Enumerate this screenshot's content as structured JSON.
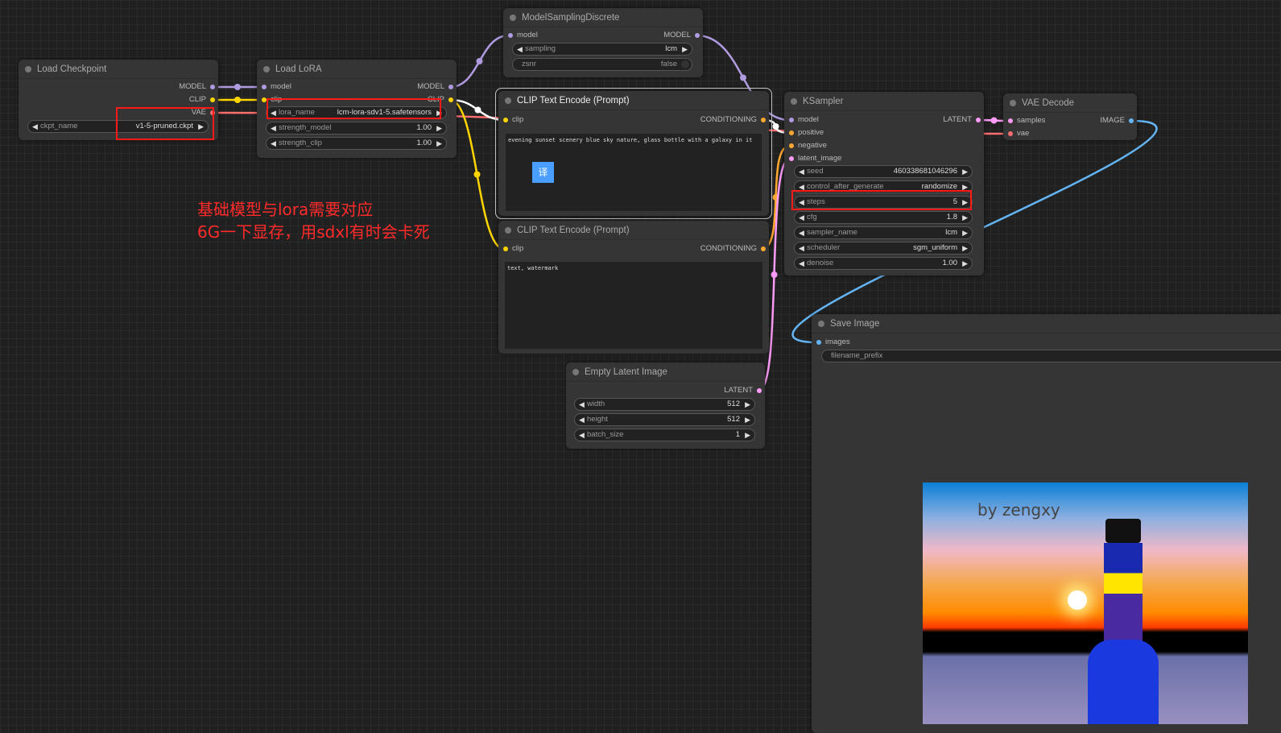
{
  "colors": {
    "model": "#b09ae0",
    "clip": "#ffd500",
    "vae": "#ff6e6e",
    "conditioning": "#ffa931",
    "latent": "#ff9cf9",
    "image": "#64b5f6",
    "highlight": "#ff1a1a"
  },
  "annotation": {
    "line1": "基础模型与lora需要对应",
    "line2": "6G一下显存，用sdxl有时会卡死"
  },
  "load_checkpoint": {
    "title": "Load Checkpoint",
    "outputs": [
      "MODEL",
      "CLIP",
      "VAE"
    ],
    "ckpt_name": {
      "label": "ckpt_name",
      "value": "v1-5-pruned.ckpt"
    }
  },
  "load_lora": {
    "title": "Load LoRA",
    "inputs": [
      "model",
      "clip"
    ],
    "outputs": [
      "MODEL",
      "CLIP"
    ],
    "widgets": [
      {
        "label": "lora_name",
        "value": "lcm-lora-sdv1-5.safetensors"
      },
      {
        "label": "strength_model",
        "value": "1.00"
      },
      {
        "label": "strength_clip",
        "value": "1.00"
      }
    ]
  },
  "model_sampling": {
    "title": "ModelSamplingDiscrete",
    "input": "model",
    "output": "MODEL",
    "sampling": {
      "label": "sampling",
      "value": "lcm"
    },
    "zsnr": {
      "label": "zsnr",
      "value": "false"
    }
  },
  "clip_pos": {
    "title": "CLIP Text Encode (Prompt)",
    "input": "clip",
    "output": "CONDITIONING",
    "text": "evening sunset scenery blue sky nature, glass bottle with a galaxy in it",
    "translate_button": "译"
  },
  "clip_neg": {
    "title": "CLIP Text Encode (Prompt)",
    "input": "clip",
    "output": "CONDITIONING",
    "text": "text, watermark"
  },
  "empty_latent": {
    "title": "Empty Latent Image",
    "output": "LATENT",
    "widgets": [
      {
        "label": "width",
        "value": "512"
      },
      {
        "label": "height",
        "value": "512"
      },
      {
        "label": "batch_size",
        "value": "1"
      }
    ]
  },
  "ksampler": {
    "title": "KSampler",
    "inputs": [
      "model",
      "positive",
      "negative",
      "latent_image"
    ],
    "output": "LATENT",
    "widgets": [
      {
        "label": "seed",
        "value": "460338681046296"
      },
      {
        "label": "control_after_generate",
        "value": "randomize"
      },
      {
        "label": "steps",
        "value": "5"
      },
      {
        "label": "cfg",
        "value": "1.8"
      },
      {
        "label": "sampler_name",
        "value": "lcm"
      },
      {
        "label": "scheduler",
        "value": "sgm_uniform"
      },
      {
        "label": "denoise",
        "value": "1.00"
      }
    ]
  },
  "vae_decode": {
    "title": "VAE Decode",
    "inputs": [
      "samples",
      "vae"
    ],
    "output": "IMAGE"
  },
  "save_image": {
    "title": "Save Image",
    "input": "images",
    "filename_prefix": {
      "label": "filename_prefix"
    },
    "watermark": "by zengxy"
  }
}
